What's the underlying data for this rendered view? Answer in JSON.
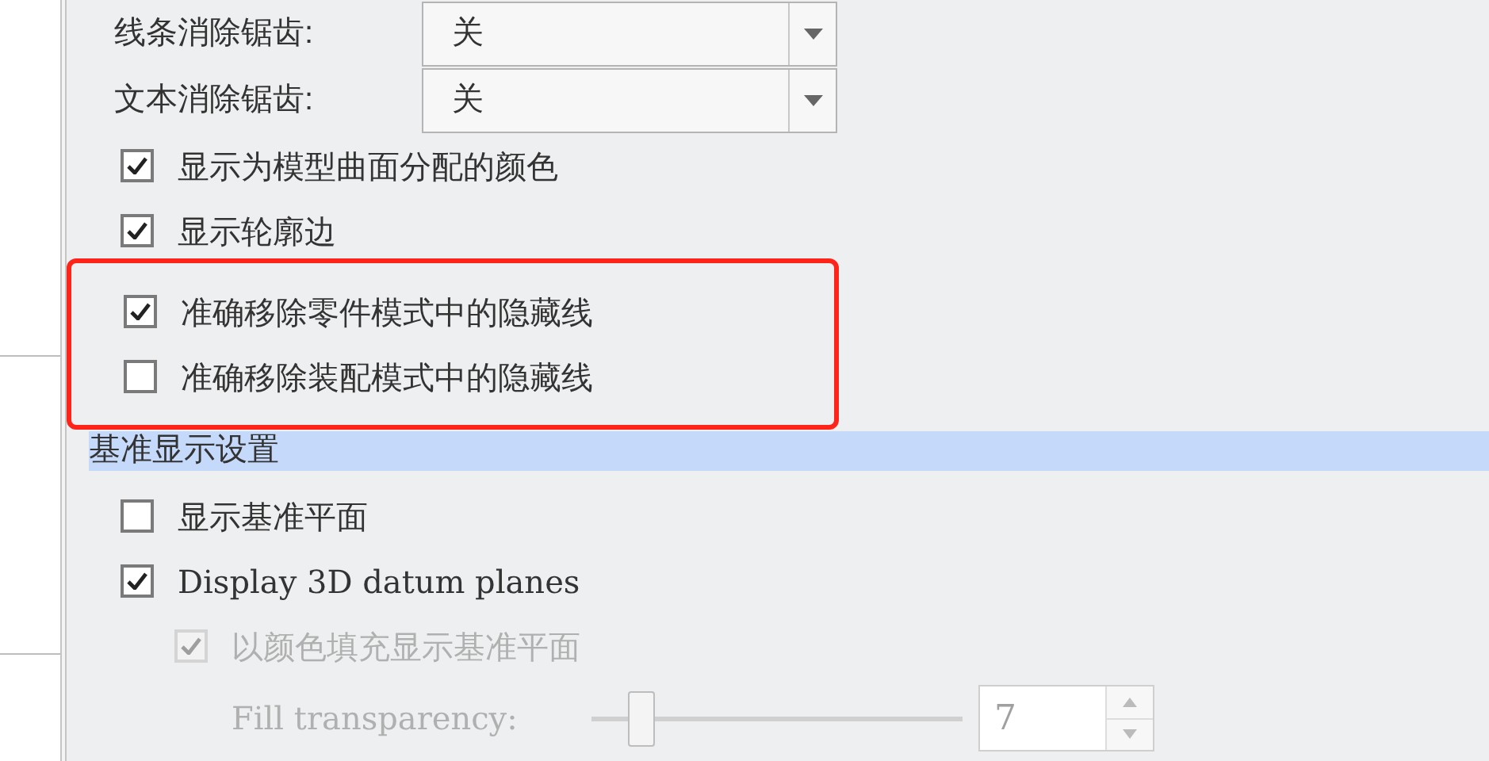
{
  "settings": [
    {
      "kind": "dropdown",
      "label": "线条消除锯齿:",
      "value": "关",
      "highlighted": false
    },
    {
      "kind": "dropdown",
      "label": "文本消除锯齿:",
      "value": "关",
      "highlighted": false
    },
    {
      "kind": "checkbox",
      "label": "显示为模型曲面分配的颜色",
      "checked": true,
      "disabled": false,
      "highlighted": false
    },
    {
      "kind": "checkbox",
      "label": "显示轮廓边",
      "checked": true,
      "disabled": false,
      "highlighted": false
    },
    {
      "kind": "checkbox",
      "label": "准确移除零件模式中的隐藏线",
      "checked": true,
      "disabled": false,
      "highlighted": true
    },
    {
      "kind": "checkbox",
      "label": "准确移除装配模式中的隐藏线",
      "checked": false,
      "disabled": false,
      "highlighted": true
    },
    {
      "kind": "section",
      "label": "基准显示设置"
    },
    {
      "kind": "checkbox",
      "label": "显示基准平面",
      "checked": false,
      "disabled": false,
      "highlighted": false
    },
    {
      "kind": "checkbox",
      "label": "Display 3D datum planes",
      "checked": true,
      "disabled": false,
      "highlighted": false
    },
    {
      "kind": "checkbox",
      "label": "以颜色填充显示基准平面",
      "checked": true,
      "disabled": true,
      "indented": true,
      "highlighted": false
    },
    {
      "kind": "slider",
      "label": "Fill transparency:",
      "level": 0.1,
      "value": "7",
      "disabled": true,
      "highlighted": false
    }
  ]
}
